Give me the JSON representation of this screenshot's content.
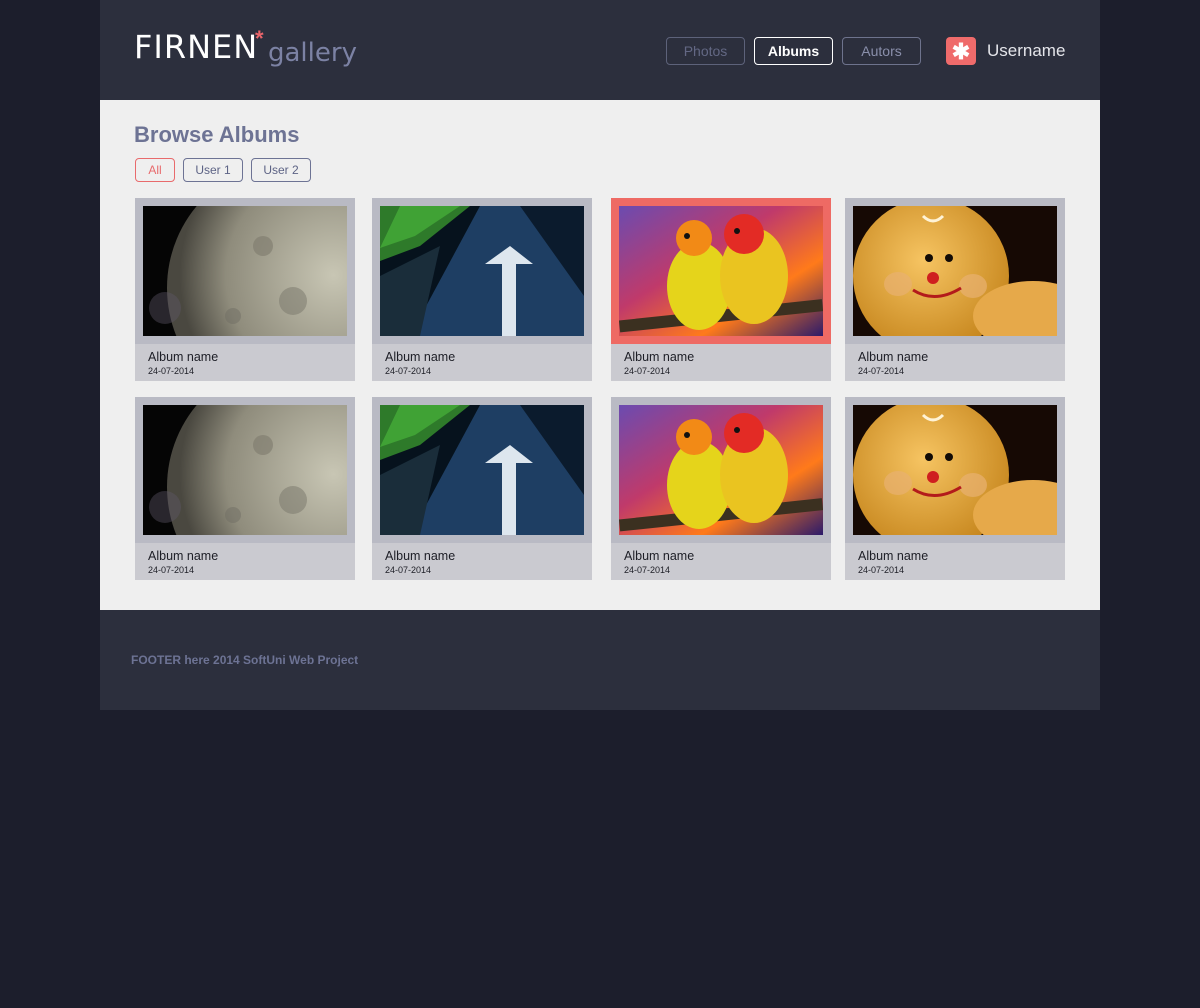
{
  "header": {
    "logo_main": "FIRNEN",
    "logo_star": "*",
    "logo_sub": "gallery",
    "nav": {
      "photos": "Photos",
      "albums": "Albums",
      "autors": "Autors"
    },
    "user_icon": "✱",
    "username": "Username"
  },
  "main": {
    "title": "Browse Albums",
    "filters": [
      "All",
      "User 1",
      "User 2"
    ],
    "albums": [
      {
        "name": "Album name",
        "date": "24-07-2014",
        "image": "moon"
      },
      {
        "name": "Album name",
        "date": "24-07-2014",
        "image": "road-arrow"
      },
      {
        "name": "Album name",
        "date": "24-07-2014",
        "image": "parrots"
      },
      {
        "name": "Album name",
        "date": "24-07-2014",
        "image": "cookie-face"
      },
      {
        "name": "Album name",
        "date": "24-07-2014",
        "image": "moon"
      },
      {
        "name": "Album name",
        "date": "24-07-2014",
        "image": "road-arrow"
      },
      {
        "name": "Album name",
        "date": "24-07-2014",
        "image": "parrots"
      },
      {
        "name": "Album name",
        "date": "24-07-2014",
        "image": "cookie-face"
      }
    ]
  },
  "footer": {
    "text": "FOOTER here  2014 SoftUni Web Project"
  },
  "colors": {
    "accent": "#ee6a64",
    "background": "#1c1e2c",
    "panel": "#2c2f3d"
  }
}
